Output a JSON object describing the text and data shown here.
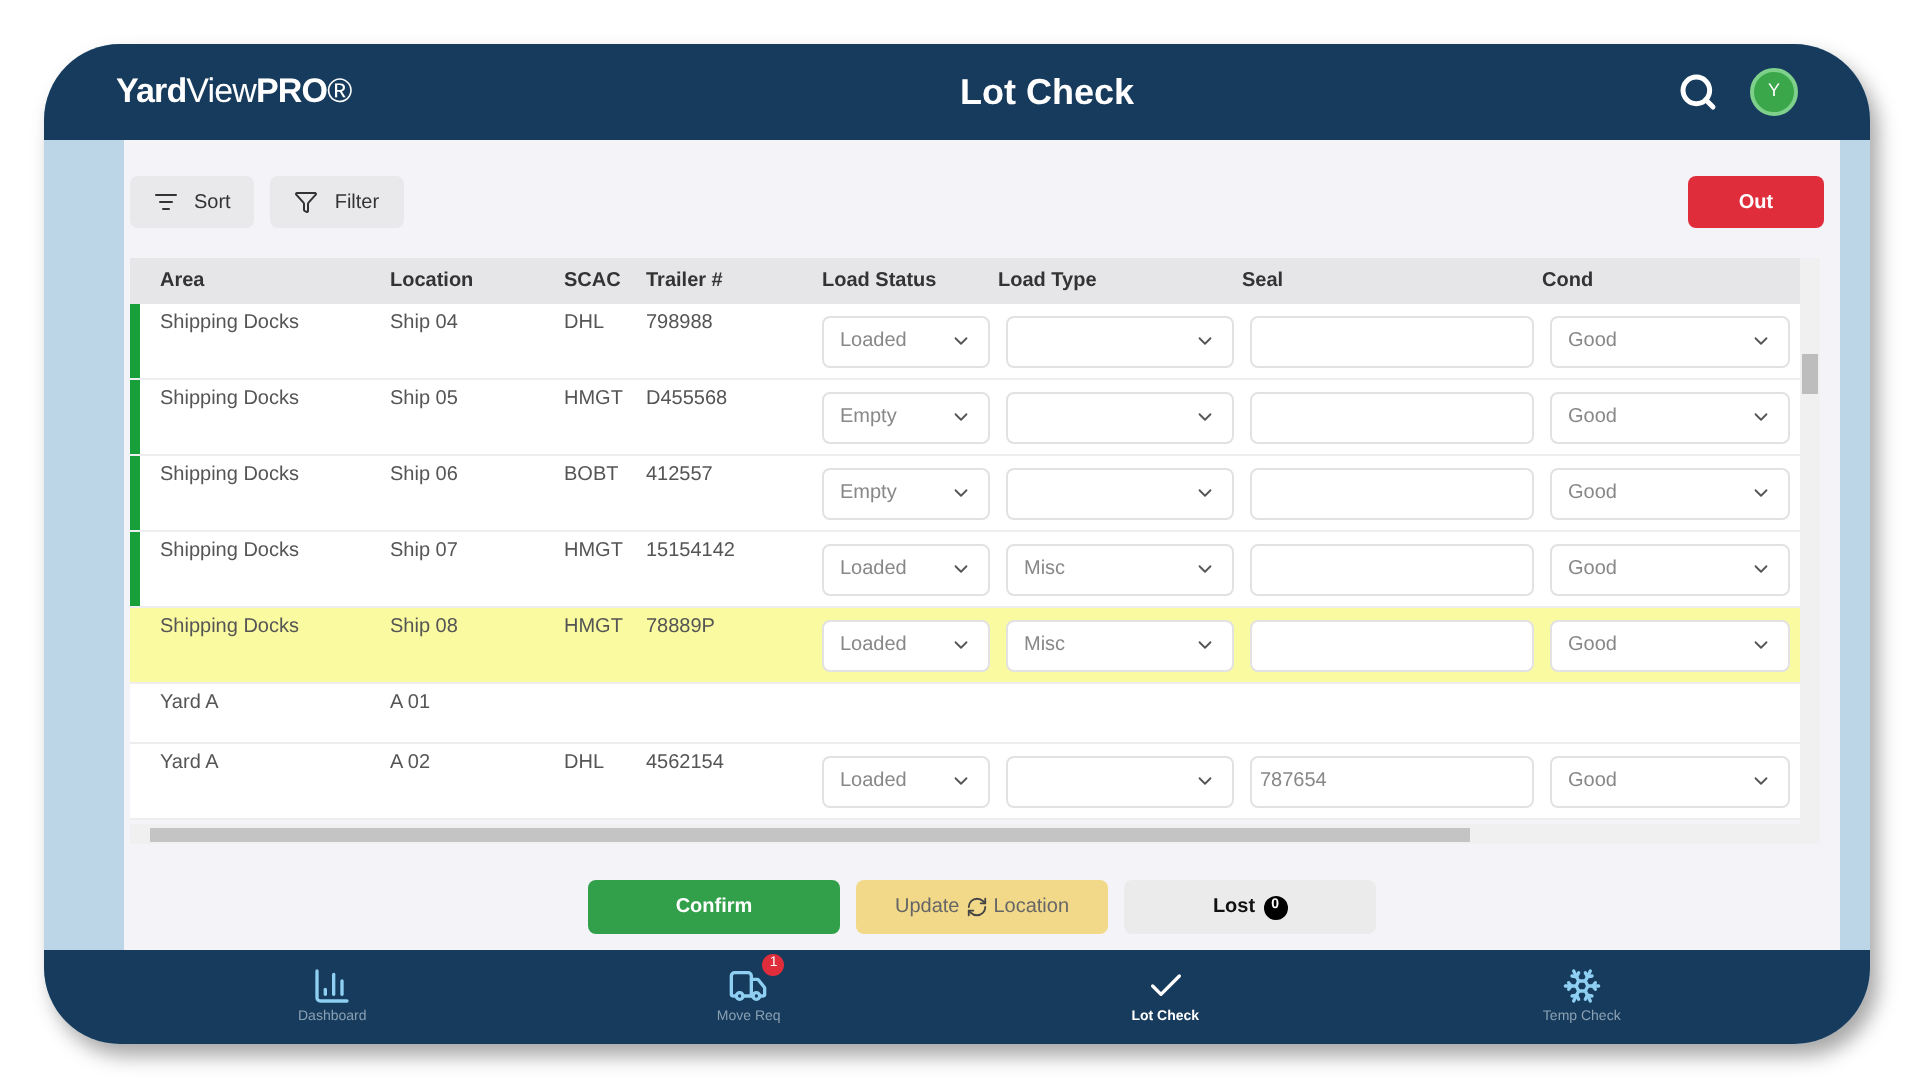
{
  "header": {
    "logo": "**Yard**View**PRO**®",
    "title": "Lot Check",
    "avatar": "Y"
  },
  "toolbar": {
    "sort": "Sort",
    "filter": "Filter",
    "out": "Out"
  },
  "table": {
    "columns": [
      "Area",
      "Location",
      "SCAC",
      "Trailer #",
      "Load Status",
      "Load Type",
      "Seal",
      "Cond"
    ],
    "rows": [
      {
        "kind": "full",
        "marked": true,
        "selected": false,
        "area": "Shipping Docks",
        "location": "Ship 04",
        "scac": "DHL",
        "trailer": "798988",
        "load_status": "Loaded",
        "cond": "Good"
      },
      {
        "kind": "full",
        "marked": true,
        "selected": false,
        "area": "Shipping Docks",
        "location": "Ship 05",
        "scac": "HMGT",
        "trailer": "D455568",
        "load_status": "Empty",
        "cond": "Good"
      },
      {
        "kind": "full",
        "marked": true,
        "selected": false,
        "area": "Shipping Docks",
        "location": "Ship 06",
        "scac": "BOBT",
        "trailer": "412557",
        "load_status": "Empty",
        "cond": "Good"
      },
      {
        "kind": "full",
        "marked": true,
        "selected": false,
        "area": "Shipping Docks",
        "location": "Ship 07",
        "scac": "HMGT",
        "trailer": "15154142",
        "load_status": "Loaded",
        "load_type": "Misc",
        "cond": "Good"
      },
      {
        "kind": "full",
        "marked": false,
        "selected": true,
        "area": "Shipping Docks",
        "location": "Ship 08",
        "scac": "HMGT",
        "trailer": "78889P",
        "load_status": "Loaded",
        "load_type": "Misc",
        "cond": "Good"
      },
      {
        "kind": "vacant",
        "marked": false,
        "selected": false,
        "area": "Yard A",
        "location": "A 01"
      },
      {
        "kind": "full",
        "marked": false,
        "selected": false,
        "area": "Yard A",
        "location": "A 02",
        "scac": "DHL",
        "trailer": "4562154",
        "load_status": "Loaded",
        "seal": "787654",
        "cond": "Good"
      }
    ]
  },
  "actions": {
    "confirm": "Confirm",
    "update_before": "Update",
    "update_after": "Location",
    "lost": "Lost",
    "lost_badge": "0"
  },
  "nav": [
    {
      "kind": "dashboard",
      "label": "Dashboard",
      "selected": false
    },
    {
      "kind": "move",
      "label": "Move Req",
      "selected": false,
      "badge": "1"
    },
    {
      "kind": "check",
      "label": "Lot Check",
      "selected": true
    },
    {
      "kind": "snow",
      "label": "Temp Check",
      "selected": false
    }
  ]
}
